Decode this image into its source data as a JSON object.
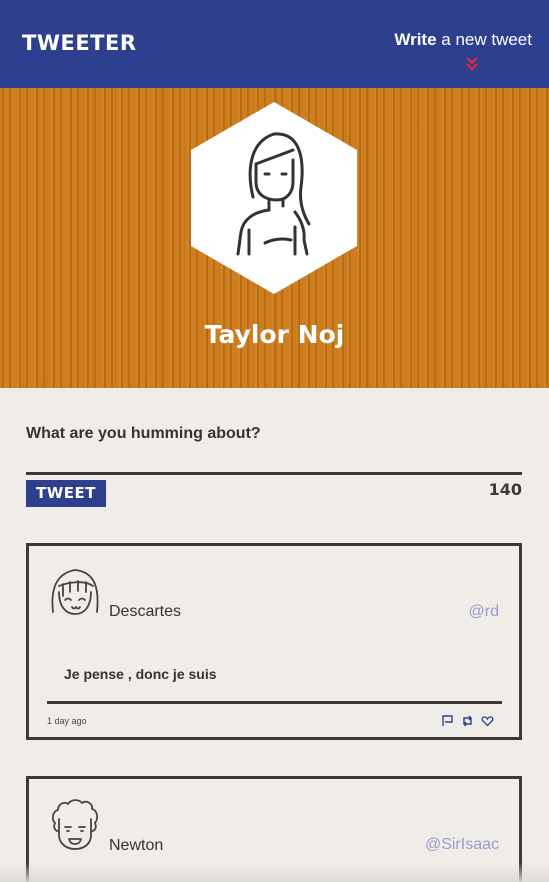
{
  "header": {
    "brand": "TWEETER",
    "compose_bold": "Write",
    "compose_rest": " a new tweet",
    "compose_icon": "double-chevron-down-icon",
    "colors": {
      "bar": "#2f3f8f",
      "chevron": "#e0253a"
    }
  },
  "profile": {
    "name": "Taylor Noj",
    "avatar_icon": "woman-long-hair-avatar"
  },
  "composer": {
    "prompt": "What are you humming about?",
    "button_label": "TWEET",
    "char_count": "140"
  },
  "tweets": [
    {
      "author": "Descartes",
      "handle": "@rd",
      "text": "Je pense , donc je suis",
      "time": "1 day ago",
      "avatar_icon": "girl-bangs-avatar",
      "actions": [
        "flag-icon",
        "retweet-icon",
        "heart-icon"
      ]
    },
    {
      "author": "Newton",
      "handle": "@SirIsaac",
      "avatar_icon": "curly-hair-man-avatar"
    }
  ]
}
